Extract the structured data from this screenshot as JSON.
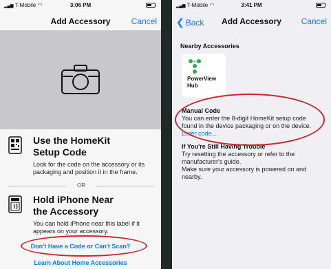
{
  "left_screen": {
    "status": {
      "carrier": "T-Mobile",
      "time": "3:06 PM"
    },
    "nav": {
      "title": "Add Accessory",
      "cancel": "Cancel"
    },
    "option1": {
      "title_line1": "Use the HomeKit",
      "title_line2": "Setup Code",
      "desc_line1": "Look for the code on the accessory or its",
      "desc_line2": "packaging and position it in the frame."
    },
    "or_label": "OR",
    "option2": {
      "title_line1": "Hold iPhone Near",
      "title_line2": "the Accessory",
      "desc_line1": "You can hold iPhone near this label if it",
      "desc_line2": "appears on your accessory."
    },
    "no_code_link": "Don't Have a Code or Can't Scan?",
    "learn_link": "Learn About Home Accessories"
  },
  "right_screen": {
    "status": {
      "carrier": "T-Mobile",
      "time": "3:41 PM"
    },
    "nav": {
      "back": "Back",
      "title": "Add Accessory",
      "cancel": "Cancel"
    },
    "nearby_title": "Nearby Accessories",
    "accessory": {
      "name_line1": "PowerView",
      "name_line2": "Hub"
    },
    "manual": {
      "title": "Manual Code",
      "line1": "You can enter the 8-digit HomeKit setup code",
      "line2": "found in the device packaging or on the device.",
      "enter_code": "Enter code..."
    },
    "trouble": {
      "title": "If You're Still Having Trouble",
      "line1": "Try resetting the accessory or refer to the",
      "line2": "manufacturer's guide.",
      "line3": "Make sure your accessory is powered on and",
      "line4": "nearby."
    }
  },
  "colors": {
    "accent": "#0a7aff",
    "annotation": "#c7282c",
    "hub_green": "#3aa851"
  },
  "icons": [
    "wifi-icon",
    "battery-icon",
    "camera-icon",
    "qr-code-icon",
    "nfc-tag-icon",
    "chevron-left-icon",
    "hub-icon"
  ]
}
